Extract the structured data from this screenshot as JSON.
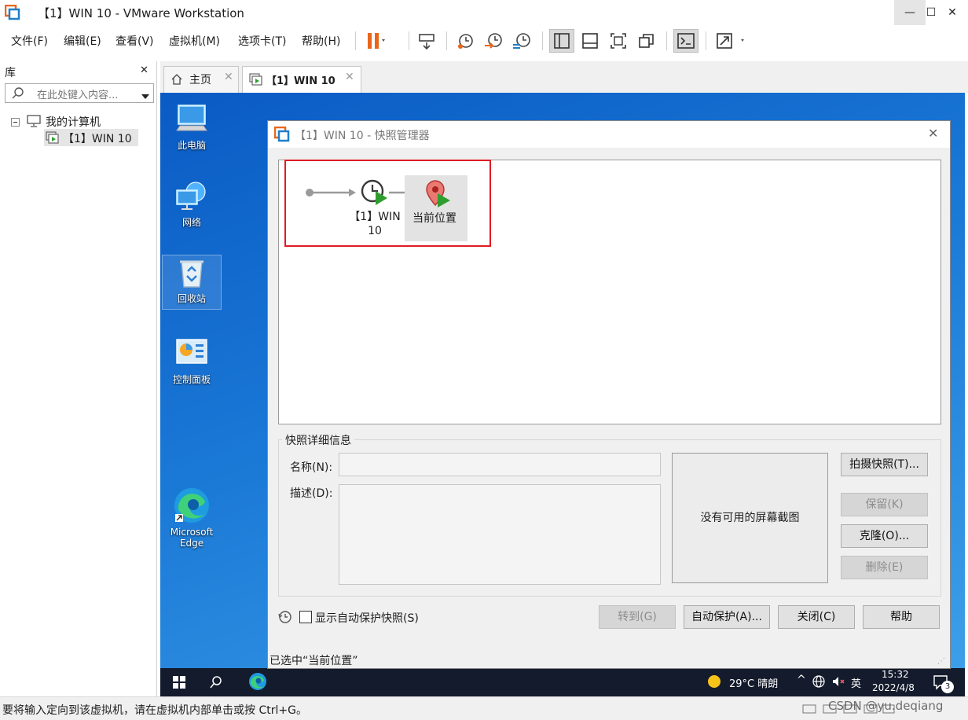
{
  "window": {
    "title": "【1】WIN 10 - VMware Workstation",
    "minimize": "—",
    "maximize": "☐",
    "close": "✕"
  },
  "menu": {
    "items": [
      "文件(F)",
      "编辑(E)",
      "查看(V)",
      "虚拟机(M)",
      "选项卡(T)",
      "帮助(H)"
    ]
  },
  "library": {
    "title": "库",
    "close": "✕",
    "search_placeholder": "在此处键入内容...",
    "tree": {
      "root": "我的计算机",
      "child": "【1】WIN 10"
    }
  },
  "tabs": [
    {
      "label": "主页"
    },
    {
      "label": "【1】WIN 10"
    }
  ],
  "desktop": {
    "icons": [
      "此电脑",
      "网络",
      "回收站",
      "控制面板",
      "Microsoft Edge"
    ]
  },
  "taskbar": {
    "weather": "29°C 晴朗",
    "ime": "英",
    "time": "15:32",
    "date": "2022/4/8",
    "notif_count": "3"
  },
  "dialog": {
    "title": "【1】WIN 10 - 快照管理器",
    "snapshot_label": "【1】WIN 10",
    "current_label": "当前位置",
    "details_group": "快照详细信息",
    "name_label": "名称(N):",
    "desc_label": "描述(D):",
    "no_screenshot": "没有可用的屏幕截图",
    "buttons": {
      "take": "拍摄快照(T)...",
      "keep": "保留(K)",
      "clone": "克隆(O)...",
      "delete": "删除(E)",
      "goto": "转到(G)",
      "autoprotect": "自动保护(A)...",
      "close": "关闭(C)",
      "help": "帮助"
    },
    "show_autoprotect": "显示自动保护快照(S)",
    "status": "已选中“当前位置”"
  },
  "statusbar": {
    "text": "要将输入定向到该虚拟机，请在虚拟机内部单击或按 Ctrl+G。",
    "watermark": "CSDN @yu.deqiang"
  },
  "colors": {
    "accent_orange": "#e8661b",
    "highlight_red": "#e01b24",
    "desktop_blue": "#1a78d6",
    "play_green": "#2e9e2e"
  }
}
